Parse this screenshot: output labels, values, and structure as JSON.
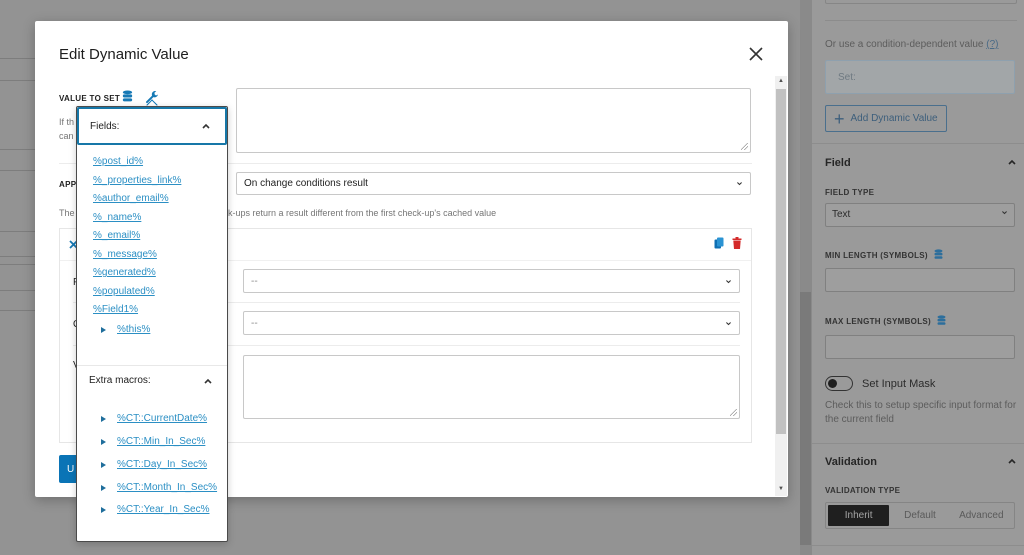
{
  "sidebar": {
    "condition_text": "Or use a condition-dependent value",
    "condition_help_link": "(?)",
    "set_placeholder": "Set:",
    "add_dynamic_value_label": "Add Dynamic Value",
    "field_section": {
      "title": "Field",
      "field_type_label": "FIELD TYPE",
      "field_type_value": "Text",
      "min_length_label": "MIN LENGTH (SYMBOLS)",
      "max_length_label": "MAX LENGTH (SYMBOLS)",
      "min_length_value": "",
      "max_length_value": "",
      "input_mask_label": "Set Input Mask",
      "input_mask_on": false,
      "input_mask_help_line1": "Check this to setup specific input format for",
      "input_mask_help_line2": "the current field"
    },
    "validation_section": {
      "title": "Validation",
      "validation_type_label": "VALIDATION TYPE",
      "options": [
        "Inherit",
        "Default",
        "Advanced"
      ],
      "selected": "Inherit"
    }
  },
  "modal": {
    "title": "Edit Dynamic Value",
    "value_to_set_label": "VALUE TO SET",
    "value_help_start": "If th",
    "value_help_start2": "can",
    "value_to_set": "",
    "apply_label_partial": "APP",
    "apply_type_value": "On change conditions result",
    "apply_help_start": "The",
    "apply_help_end": "k-ups return a result different from the first check-up's cached value",
    "condition": {
      "row1_label_partial": "F",
      "row1_value": "--",
      "row2_label_partial": "O",
      "row2_value": "--",
      "row3_label_partial": "V",
      "row3_value": ""
    },
    "update_button_partial": "U"
  },
  "macros_popover": {
    "fields_title": "Fields:",
    "fields": [
      "%post_id%",
      "%_properties_link%",
      "%author_email%",
      "%_name%",
      "%_email%",
      "%_message%",
      "%generated%",
      "%populated%",
      "%Field1%"
    ],
    "nested_field": "%this%",
    "extra_title": "Extra macros:",
    "extra": [
      "%CT::CurrentDate%",
      "%CT::Min_In_Sec%",
      "%CT::Day_In_Sec%",
      "%CT::Month_In_Sec%",
      "%CT::Year_In_Sec%"
    ]
  },
  "colors": {
    "accent": "#0a74b6",
    "link": "#2b8fc4",
    "delete": "#d42a2a"
  }
}
